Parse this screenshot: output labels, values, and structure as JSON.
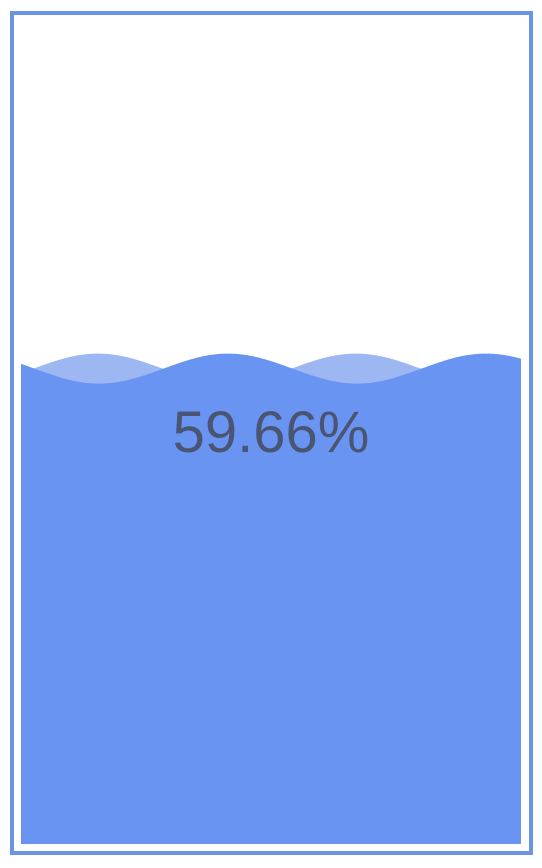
{
  "chart_data": {
    "type": "liquid-fill",
    "value": 0.5966,
    "label": "59.66%",
    "colors": {
      "border": "#6a94e6",
      "wave_back": "#9cb7f2",
      "wave_front": "#6a94f2",
      "label": "#4a5573",
      "background": "#ffffff"
    },
    "shape": "rect"
  }
}
